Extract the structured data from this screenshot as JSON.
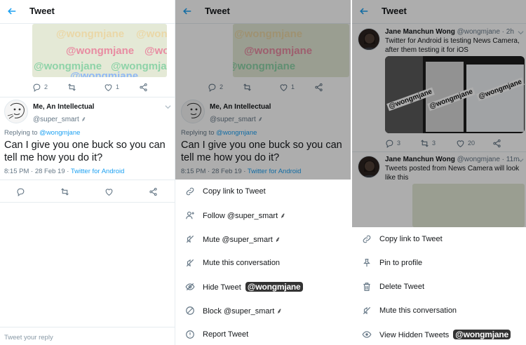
{
  "header": {
    "title": "Tweet"
  },
  "watermark": {
    "text": "@wongmjane"
  },
  "parent_tweet": {
    "actions": {
      "reply_count": "2",
      "retweet_count": "",
      "like_count": "1"
    }
  },
  "tweet": {
    "author_name": "Me, An Intellectual",
    "handle": "@super_smart",
    "handle_suffix": "⸙",
    "replying_prefix": "Replying to",
    "replying_to": "@wongmjane",
    "text": "Can I give you one buck so you can tell me how you do it?",
    "time": "8:15 PM · 28 Feb 19 ·",
    "client": "Twitter for Android"
  },
  "reply_bar": {
    "placeholder": "Tweet your reply"
  },
  "menu_other": {
    "items": [
      {
        "label": "Copy link to Tweet",
        "icon": "link-icon"
      },
      {
        "label": "Follow @super_smart ⸙",
        "icon": "follow-icon"
      },
      {
        "label": "Mute @super_smart ⸙",
        "icon": "mute-icon"
      },
      {
        "label": "Mute this conversation",
        "icon": "mute-icon"
      },
      {
        "label": "Hide Tweet",
        "icon": "hide-icon"
      },
      {
        "label": "Block @super_smart ⸙",
        "icon": "block-icon"
      },
      {
        "label": "Report Tweet",
        "icon": "report-icon"
      }
    ],
    "hide_badge": "@wongmjane"
  },
  "timeline": {
    "tweets": [
      {
        "name": "Jane Manchun Wong",
        "handle": "@wongmjane · 2h",
        "text": "Twitter for Android is testing News Camera, after them testing it for iOS",
        "reply_count": "3",
        "retweet_count": "3",
        "like_count": "20",
        "media_watermark": "@wongmjane"
      },
      {
        "name": "Jane Manchun Wong",
        "handle": "@wongmjane · 11m",
        "text": "Tweets posted from News Camera will look like this"
      }
    ]
  },
  "menu_own": {
    "items": [
      {
        "label": "Copy link to Tweet",
        "icon": "link-icon"
      },
      {
        "label": "Pin to profile",
        "icon": "pin-icon"
      },
      {
        "label": "Delete Tweet",
        "icon": "trash-icon"
      },
      {
        "label": "Mute this conversation",
        "icon": "mute-icon"
      },
      {
        "label": "View Hidden Tweets",
        "icon": "eye-icon"
      }
    ],
    "view_hidden_badge": "@wongmjane"
  },
  "colors": {
    "accent": "#1da1f2",
    "text": "#14171a",
    "muted": "#657786",
    "overlay": "rgba(0,0,0,0.32)"
  }
}
